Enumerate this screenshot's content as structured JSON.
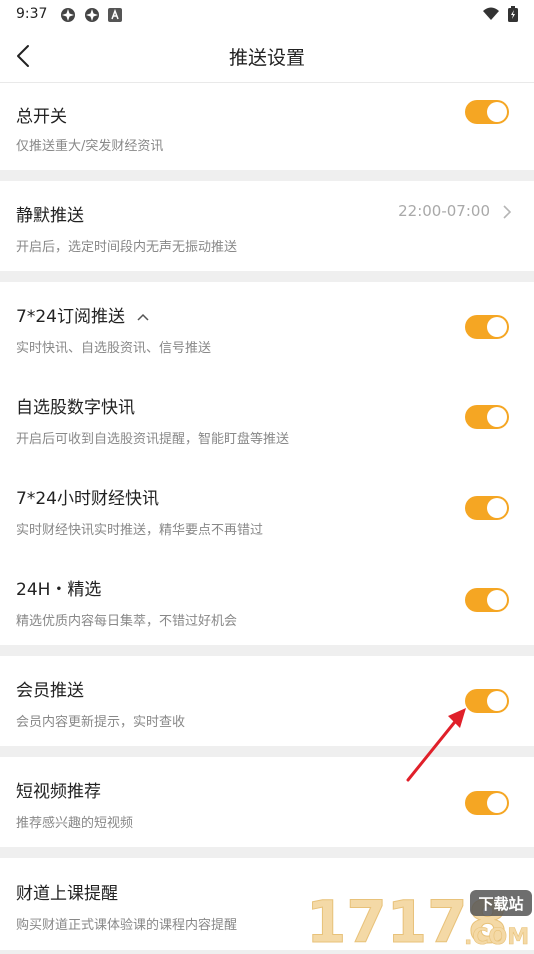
{
  "status": {
    "time": "9:37"
  },
  "header": {
    "title": "推送设置"
  },
  "rows": {
    "master": {
      "title": "总开关",
      "subtitle": "仅推送重大/突发财经资讯",
      "on": true
    },
    "quiet": {
      "title": "静默推送",
      "subtitle": "开启后，选定时间段内无声无振动推送",
      "value": "22:00-07:00"
    },
    "sub724": {
      "title": "7*24订阅推送",
      "subtitle": "实时快讯、自选股资讯、信号推送",
      "on": true
    },
    "watchlist": {
      "title": "自选股数字快讯",
      "subtitle": "开启后可收到自选股资讯提醒，智能盯盘等推送",
      "on": true
    },
    "hour724": {
      "title": "7*24小时财经快讯",
      "subtitle": "实时财经快讯实时推送，精华要点不再错过",
      "on": true
    },
    "picks": {
      "title": "24H・精选",
      "subtitle": "精选优质内容每日集萃，不错过好机会",
      "on": true
    },
    "member": {
      "title": "会员推送",
      "subtitle": "会员内容更新提示，实时查收",
      "on": true
    },
    "video": {
      "title": "短视频推荐",
      "subtitle": "推荐感兴趣的短视频",
      "on": true
    },
    "class": {
      "title": "财道上课提醒",
      "subtitle": "购买财道正式课体验课的课程内容提醒"
    }
  },
  "watermark": {
    "numbers": "17178",
    "site": ".COM",
    "tag": "下载站"
  },
  "colors": {
    "accent": "#f5a623",
    "annotation": "#e0202a"
  }
}
